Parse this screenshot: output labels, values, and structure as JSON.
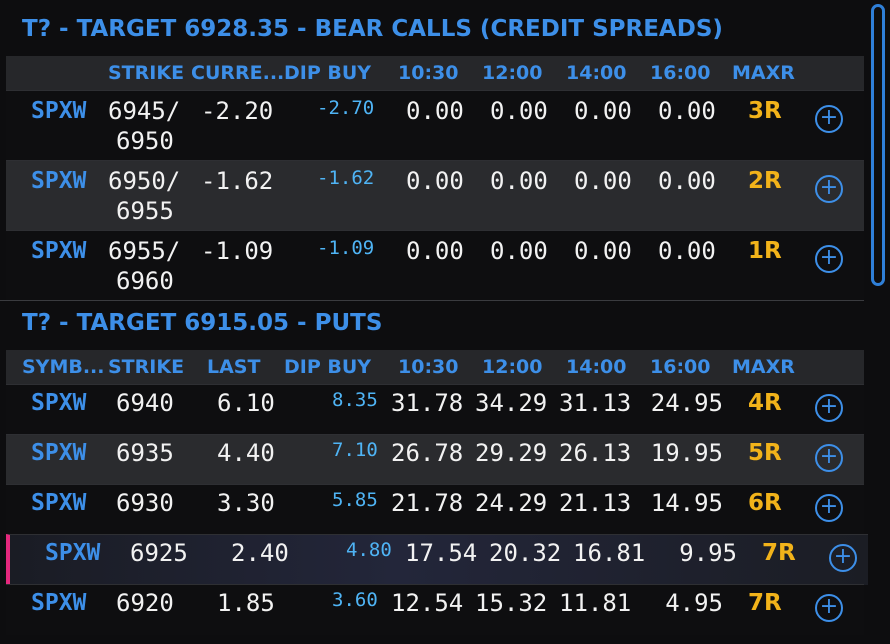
{
  "bear_calls": {
    "title": "T? - TARGET 6928.35 - BEAR CALLS (CREDIT SPREADS)",
    "headers": [
      "STRIKE",
      "CURRE...",
      "DIP BUY",
      "10:30",
      "12:00",
      "14:00",
      "16:00",
      "MAXR"
    ],
    "rows": [
      {
        "symbol": "SPXW",
        "strike_top": "6945/",
        "strike_bottom": "6950",
        "current": "-2.20",
        "dip_buy": "-2.70",
        "t1030": "0.00",
        "t1200": "0.00",
        "t1400": "0.00",
        "t1600": "0.00",
        "maxr": "3R"
      },
      {
        "symbol": "SPXW",
        "strike_top": "6950/",
        "strike_bottom": "6955",
        "current": "-1.62",
        "dip_buy": "-1.62",
        "t1030": "0.00",
        "t1200": "0.00",
        "t1400": "0.00",
        "t1600": "0.00",
        "maxr": "2R"
      },
      {
        "symbol": "SPXW",
        "strike_top": "6955/",
        "strike_bottom": "6960",
        "current": "-1.09",
        "dip_buy": "-1.09",
        "t1030": "0.00",
        "t1200": "0.00",
        "t1400": "0.00",
        "t1600": "0.00",
        "maxr": "1R"
      }
    ]
  },
  "puts": {
    "title": "T? - TARGET 6915.05 - PUTS",
    "headers": [
      "SYMB...",
      "STRIKE",
      "LAST",
      "DIP BUY",
      "10:30",
      "12:00",
      "14:00",
      "16:00",
      "MAXR"
    ],
    "rows": [
      {
        "symbol": "SPXW",
        "strike": "6940",
        "last": "6.10",
        "dip_buy": "8.35",
        "t1030": "31.78",
        "t1200": "34.29",
        "t1400": "31.13",
        "t1600": "24.95",
        "maxr": "4R"
      },
      {
        "symbol": "SPXW",
        "strike": "6935",
        "last": "4.40",
        "dip_buy": "7.10",
        "t1030": "26.78",
        "t1200": "29.29",
        "t1400": "26.13",
        "t1600": "19.95",
        "maxr": "5R"
      },
      {
        "symbol": "SPXW",
        "strike": "6930",
        "last": "3.30",
        "dip_buy": "5.85",
        "t1030": "21.78",
        "t1200": "24.29",
        "t1400": "21.13",
        "t1600": "14.95",
        "maxr": "6R"
      },
      {
        "symbol": "SPXW",
        "strike": "6925",
        "last": "2.40",
        "dip_buy": "4.80",
        "t1030": "17.54",
        "t1200": "20.32",
        "t1400": "16.81",
        "t1600": "9.95",
        "maxr": "7R"
      },
      {
        "symbol": "SPXW",
        "strike": "6920",
        "last": "1.85",
        "dip_buy": "3.60",
        "t1030": "12.54",
        "t1200": "15.32",
        "t1400": "11.81",
        "t1600": "4.95",
        "maxr": "7R"
      }
    ]
  },
  "icons": {
    "add": "plus-circle-icon"
  },
  "colors": {
    "accent": "#3d8fe8",
    "maxr": "#f2b31a",
    "dip": "#4fb4f5",
    "highlight_marker": "#e5287d"
  }
}
